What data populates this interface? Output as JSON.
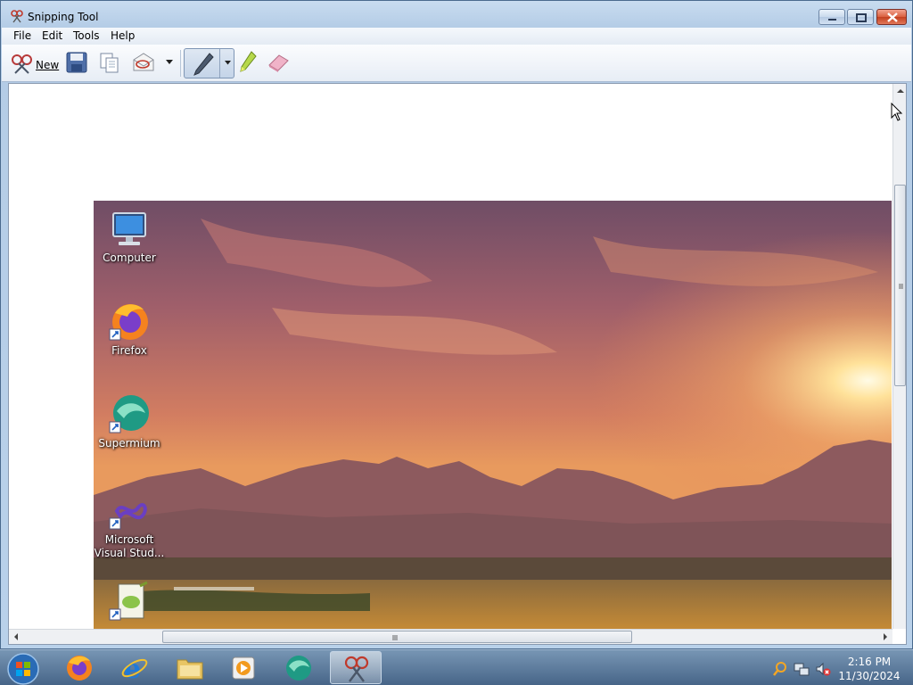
{
  "window": {
    "title": "Snipping Tool"
  },
  "menu": {
    "items": [
      "File",
      "Edit",
      "Tools",
      "Help"
    ]
  },
  "toolbar": {
    "new_label": "New",
    "icons": [
      "scissors-icon",
      "save-icon",
      "copy-icon",
      "send-snip-icon",
      "dropdown-arrow-icon",
      "pen-icon",
      "highlighter-icon",
      "eraser-icon"
    ]
  },
  "desktop_icons": [
    {
      "label": "Computer",
      "icon": "computer-icon"
    },
    {
      "label": "Firefox",
      "icon": "firefox-icon"
    },
    {
      "label": "Supermium",
      "icon": "supermium-icon"
    },
    {
      "label": "Microsoft Visual Stud...",
      "icon": "visual-studio-icon"
    }
  ],
  "taskbar": {
    "apps": [
      "start-orb-icon",
      "firefox-icon",
      "internet-explorer-icon",
      "file-explorer-icon",
      "media-player-icon",
      "supermium-icon",
      "snipping-tool-icon"
    ],
    "tray": [
      "search-tray-icon",
      "network-icon",
      "volume-muted-icon"
    ],
    "time": "2:16 PM",
    "date": "11/30/2024"
  },
  "colors": {
    "sky_top": "#8a5a6e",
    "sunset": "#e8925a",
    "mountain": "#8a5a62",
    "field": "#c88a3a"
  }
}
